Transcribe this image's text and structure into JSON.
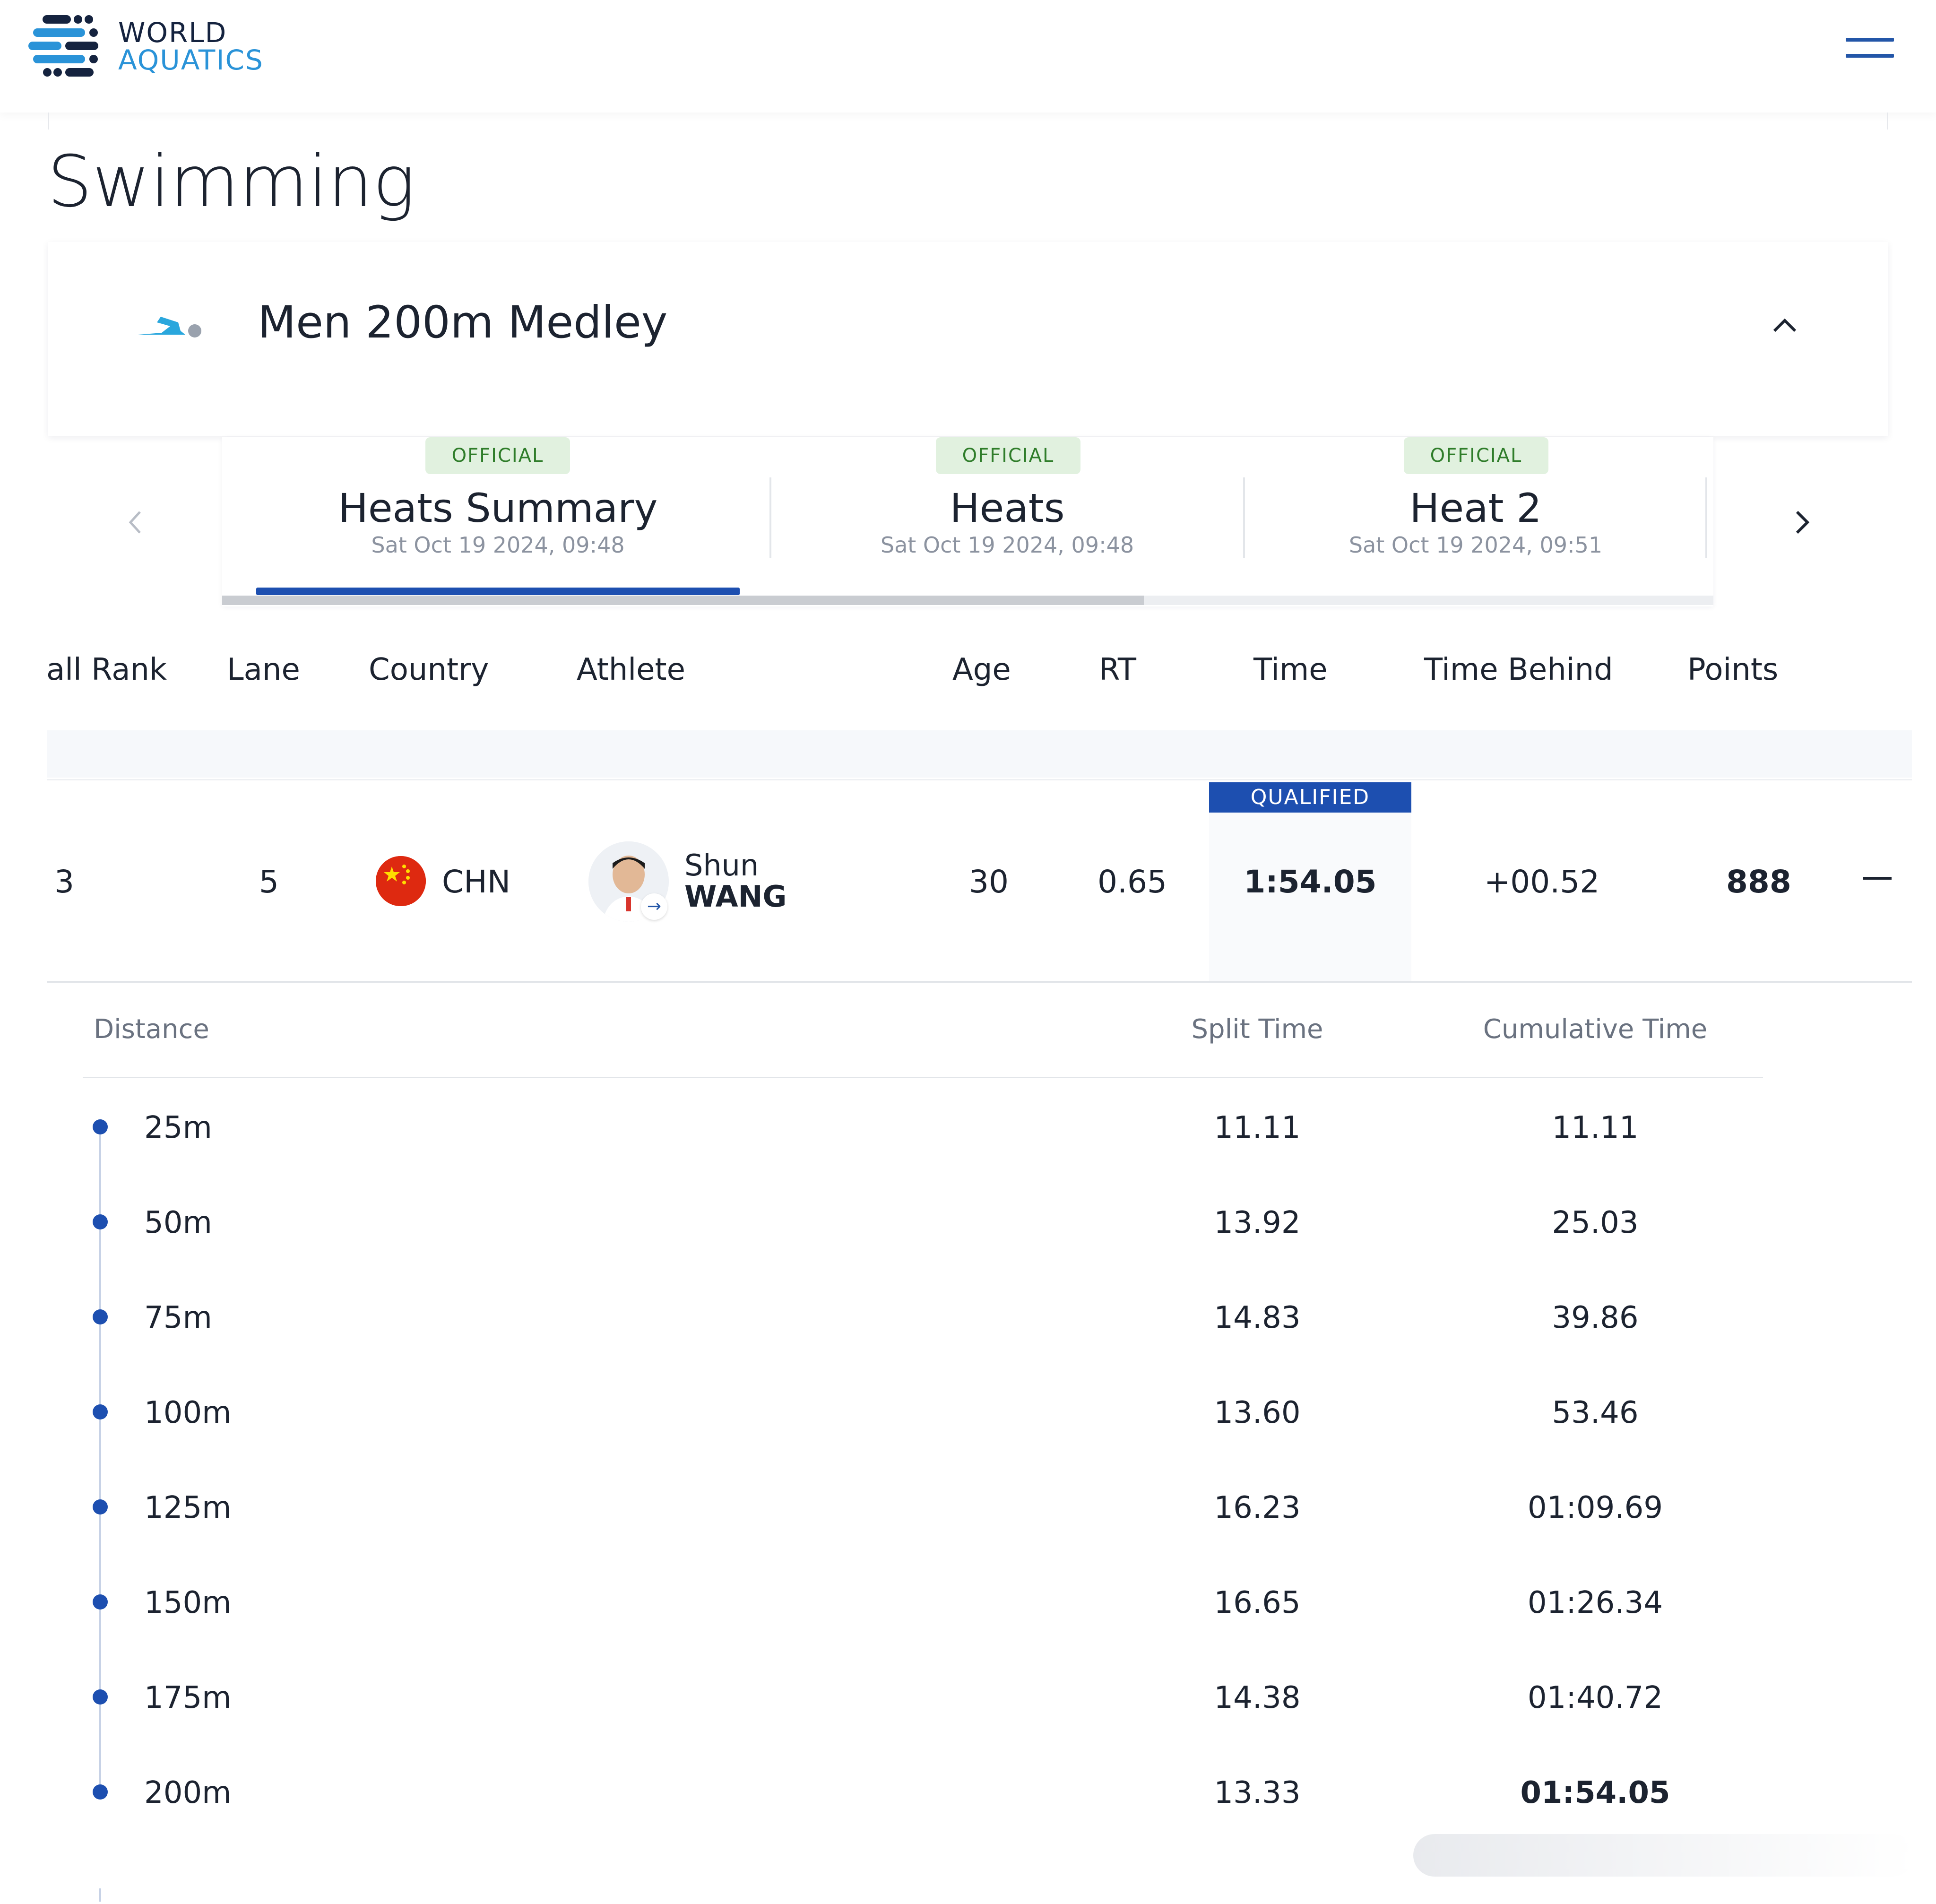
{
  "header": {
    "logo_line1": "WORLD",
    "logo_line2": "AQUATICS",
    "brand_colors": {
      "navy": "#15233f",
      "blue": "#2a93d8",
      "accent": "#1d4fb0"
    },
    "menu_icon": "hamburger-menu-icon"
  },
  "page": {
    "title": "Swimming"
  },
  "event": {
    "title": "Men 200m Medley",
    "icon": "swimmer-icon",
    "toggle_icon": "chevron-up-icon"
  },
  "tabs": [
    {
      "badge": "OFFICIAL",
      "label": "Heats Summary",
      "date": "Sat Oct 19 2024, 09:48",
      "active": true
    },
    {
      "badge": "OFFICIAL",
      "label": "Heats",
      "date": "Sat Oct 19 2024, 09:48",
      "active": false
    },
    {
      "badge": "OFFICIAL",
      "label": "Heat 2",
      "date": "Sat Oct 19 2024, 09:51",
      "active": false
    }
  ],
  "table": {
    "columns": [
      "all Rank",
      "Lane",
      "Country",
      "Athlete",
      "Age",
      "RT",
      "Time",
      "Time Behind",
      "Points"
    ],
    "row": {
      "rank": "3",
      "lane": "5",
      "country": "CHN",
      "first_name": "Shun",
      "last_name": "WANG",
      "age": "30",
      "rt": "0.65",
      "status": "QUALIFIED",
      "time": "1:54.05",
      "time_behind": "+00.52",
      "points": "888"
    }
  },
  "splits": {
    "headers": {
      "distance": "Distance",
      "split": "Split Time",
      "cumulative": "Cumulative Time"
    },
    "rows": [
      {
        "distance": "25m",
        "split": "11.11",
        "cumulative": "11.11"
      },
      {
        "distance": "50m",
        "split": "13.92",
        "cumulative": "25.03"
      },
      {
        "distance": "75m",
        "split": "14.83",
        "cumulative": "39.86"
      },
      {
        "distance": "100m",
        "split": "13.60",
        "cumulative": "53.46"
      },
      {
        "distance": "125m",
        "split": "16.23",
        "cumulative": "01:09.69"
      },
      {
        "distance": "150m",
        "split": "16.65",
        "cumulative": "01:26.34"
      },
      {
        "distance": "175m",
        "split": "14.38",
        "cumulative": "01:40.72"
      },
      {
        "distance": "200m",
        "split": "13.33",
        "cumulative": "01:54.05"
      }
    ]
  }
}
